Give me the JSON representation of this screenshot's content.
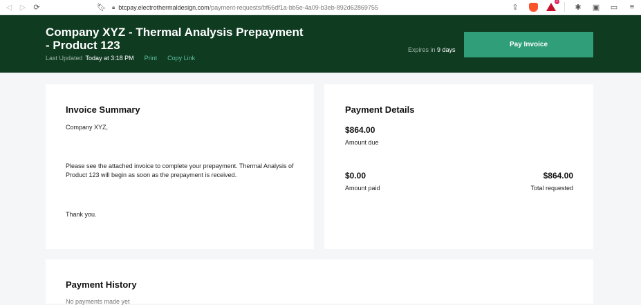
{
  "browser": {
    "url_host": "btcpay.electrothermaldesign.com",
    "url_path": "/payment-requests/bf66df1a-bb5e-4a09-b3eb-892d62869755",
    "notification_count": "1"
  },
  "header": {
    "title": "Company XYZ - Thermal Analysis Prepayment - Product 123",
    "last_updated_label": "Last Updated",
    "last_updated_value": "Today at 3:18 PM",
    "print_label": "Print",
    "copy_link_label": "Copy Link",
    "expires_label": "Expires in",
    "expires_value": "9 days",
    "pay_button_label": "Pay Invoice"
  },
  "summary": {
    "title": "Invoice Summary",
    "greeting": "Company XYZ,",
    "body": "Please see the attached invoice to complete your prepayment. Thermal Analysis of Product 123 will begin as soon as the prepayment is received.",
    "closing": "Thank you."
  },
  "details": {
    "title": "Payment Details",
    "amount_due_value": "$864.00",
    "amount_due_label": "Amount due",
    "amount_paid_value": "$0.00",
    "amount_paid_label": "Amount paid",
    "total_requested_value": "$864.00",
    "total_requested_label": "Total requested"
  },
  "history": {
    "title": "Payment History",
    "empty_text": "No payments made yet"
  },
  "colors": {
    "header_bg": "#0f3b21",
    "accent": "#2f9e79",
    "link": "#5ec0a0"
  },
  "icons": [
    "back-icon",
    "forward-icon",
    "reload-icon",
    "bookmark-icon",
    "lock-icon",
    "share-icon",
    "brave-shield-icon",
    "brave-rewards-icon",
    "extensions-icon",
    "sidebar-icon",
    "wallet-icon",
    "menu-icon"
  ]
}
